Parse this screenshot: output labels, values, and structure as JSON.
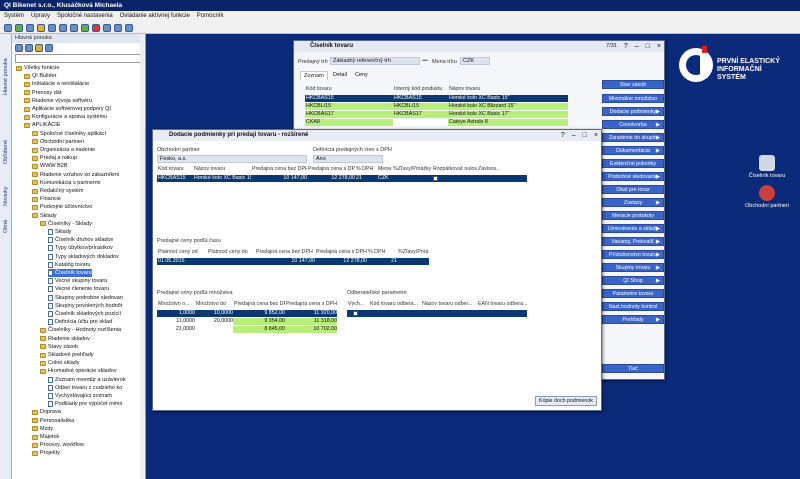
{
  "app": {
    "title": "QI  Bikenet s.r.o., Klusáčková Michaela"
  },
  "menu": [
    "Systém",
    "Úpravy",
    "Spoločné nastavenia",
    "Ovládanie aktívnej funkcie",
    "Pomocník"
  ],
  "vtabs": [
    "Hlavné ponuka",
    "Obľúbené",
    "Novinky",
    "Okná"
  ],
  "sidebar": {
    "title": "Hlavná ponuka",
    "items": [
      {
        "label": "Všetky funkcie",
        "t": "f",
        "lvl": 0
      },
      {
        "label": "QI Builder",
        "t": "f",
        "lvl": 1
      },
      {
        "label": "Inštalácie a reinštalácie",
        "t": "f",
        "lvl": 1
      },
      {
        "label": "Prenosy dát",
        "t": "f",
        "lvl": 1
      },
      {
        "label": "Riadenie vývoja softvéru",
        "t": "f",
        "lvl": 1
      },
      {
        "label": "Aplikácie softvérovej podpory QI",
        "t": "f",
        "lvl": 1
      },
      {
        "label": "Konfigurácie a správa systému",
        "t": "f",
        "lvl": 1
      },
      {
        "label": "APLIKÁCIE",
        "t": "f",
        "lvl": 1
      },
      {
        "label": "Spoločné číselníky aplikácí",
        "t": "f",
        "lvl": 2
      },
      {
        "label": "Obchodní partneri",
        "t": "f",
        "lvl": 2
      },
      {
        "label": "Organizácia a riadenie",
        "t": "f",
        "lvl": 2
      },
      {
        "label": "Predaj a nákup",
        "t": "f",
        "lvl": 2
      },
      {
        "label": "WWW B2B",
        "t": "f",
        "lvl": 2
      },
      {
        "label": "Riadenie vzťahov so zákazníkmi",
        "t": "f",
        "lvl": 2
      },
      {
        "label": "Komunikácia s partnermi",
        "t": "f",
        "lvl": 2
      },
      {
        "label": "Redakčný systém",
        "t": "f",
        "lvl": 2
      },
      {
        "label": "Financie",
        "t": "f",
        "lvl": 2
      },
      {
        "label": "Podvojné účtovníctvo",
        "t": "f",
        "lvl": 2
      },
      {
        "label": "Sklady",
        "t": "f",
        "lvl": 2
      },
      {
        "label": "Číselníky - Sklady",
        "t": "f",
        "lvl": 3
      },
      {
        "label": "Sklady",
        "t": "d",
        "lvl": 4
      },
      {
        "label": "Číselník druhov skladov",
        "t": "d",
        "lvl": 4
      },
      {
        "label": "Typy úbytkov/prírastkov",
        "t": "d",
        "lvl": 4
      },
      {
        "label": "Typy skladových dokladov",
        "t": "d",
        "lvl": 4
      },
      {
        "label": "Katalóg tovaru",
        "t": "d",
        "lvl": 4
      },
      {
        "label": "Číselník tovaru",
        "t": "d",
        "lvl": 4,
        "sel": true
      },
      {
        "label": "Vecné skupiny tovaru",
        "t": "d",
        "lvl": 4
      },
      {
        "label": "Vecné členenie tovaru",
        "t": "d",
        "lvl": 4
      },
      {
        "label": "Skupiny podrobne sledovan",
        "t": "d",
        "lvl": 4
      },
      {
        "label": "Skupiny povolených hodnôt",
        "t": "d",
        "lvl": 4
      },
      {
        "label": "Číselník skladových pozícií",
        "t": "d",
        "lvl": 4
      },
      {
        "label": "Definícia účtu pre sklad",
        "t": "d",
        "lvl": 4
      },
      {
        "label": "Číselníky - Hodnoty rozlíšenia",
        "t": "f",
        "lvl": 3
      },
      {
        "label": "Riadenie skladov",
        "t": "f",
        "lvl": 3
      },
      {
        "label": "Stavy zásob",
        "t": "f",
        "lvl": 3
      },
      {
        "label": "Skladové prehľady",
        "t": "f",
        "lvl": 3
      },
      {
        "label": "Colné sklady",
        "t": "f",
        "lvl": 3
      },
      {
        "label": "Hromadné operácie skladov",
        "t": "f",
        "lvl": 3
      },
      {
        "label": "Zoznam inventúr a uzávierok",
        "t": "d",
        "lvl": 4
      },
      {
        "label": "Odber tovaru z cudzieho ko",
        "t": "d",
        "lvl": 4
      },
      {
        "label": "Vychystávajúci zoznam",
        "t": "d",
        "lvl": 4
      },
      {
        "label": "Podklady pre výpočet mimir",
        "t": "d",
        "lvl": 4
      },
      {
        "label": "Doprava",
        "t": "f",
        "lvl": 2
      },
      {
        "label": "Personalistika",
        "t": "f",
        "lvl": 2
      },
      {
        "label": "Mzdy",
        "t": "f",
        "lvl": 2
      },
      {
        "label": "Majetok",
        "t": "f",
        "lvl": 2
      },
      {
        "label": "Procesy, workflow",
        "t": "f",
        "lvl": 2
      },
      {
        "label": "Projekty",
        "t": "f",
        "lvl": 2
      }
    ]
  },
  "logo": {
    "line1": "PRVNÍ ELASTICKÝ",
    "line2": "INFORMAČNÍ",
    "line3": "SYSTÉM"
  },
  "desktop_icons": [
    {
      "label": "Číselník tovaru"
    },
    {
      "label": "Obchodní partneri"
    }
  ],
  "main_win": {
    "title": "Číselník tovaru",
    "counter": "7/31",
    "pricelist_label": "Predajný trh",
    "pricelist_value": "Základný referenčný trh",
    "currency_label": "Mena trhu",
    "currency_value": "CZK",
    "tabs": [
      "Zoznam",
      "Detail",
      "Ceny"
    ],
    "columns": [
      "Kód tovaru",
      "Interný kód produktu",
      "Názov tovaru"
    ],
    "rows": [
      [
        "HKCBAS15",
        "HKCBAS15",
        "Horské kolo XC Basic 15\""
      ],
      [
        "HKCBLI15",
        "HKCBLI15",
        "Horské kolo XC Blizzard 15\""
      ],
      [
        "HKCBAS17",
        "HKCBAS17",
        "Horské kolo XC Basic 17\""
      ],
      [
        "CKA8",
        "",
        "Cateye Astrale 8"
      ]
    ],
    "buttons": [
      {
        "label": "Stav zásob",
        "arrow": false
      },
      {
        "label": "Minimálne množstvo",
        "arrow": false
      },
      {
        "label": "Dodacie podmienky",
        "arrow": true
      },
      {
        "label": "Cenotvorba",
        "arrow": true
      },
      {
        "label": "Zaradenie do skupín",
        "arrow": true
      },
      {
        "label": "Dokumentácia",
        "arrow": true
      },
      {
        "label": "Evidenčné jednotky",
        "arrow": false
      },
      {
        "label": "Podrobné sledovanie",
        "arrow": true
      },
      {
        "label": "Obal pre tovar",
        "arrow": false
      },
      {
        "label": "Zostavy",
        "arrow": true
      },
      {
        "label": "Meracie protokoly",
        "arrow": false
      },
      {
        "label": "Umiestnenie a sklady",
        "arrow": true
      },
      {
        "label": "Varianty, Prekvalif.",
        "arrow": true
      },
      {
        "label": "Príslušenstvo tovaru",
        "arrow": true
      },
      {
        "label": "Skupiny tovaru",
        "arrow": true
      },
      {
        "label": "QI Shop",
        "arrow": true
      },
      {
        "label": "Parametre tovaru",
        "arrow": false
      },
      {
        "label": "Nast.hodnoty kontrol",
        "arrow": false
      },
      {
        "label": "Prehľady",
        "arrow": true
      },
      {
        "label": "Tlač",
        "arrow": false
      }
    ]
  },
  "dodacie_win": {
    "title": "Dodacie podmienky pri predaji tovaru - rozšírené",
    "partner_label": "Obchodní partner",
    "partner_value": "Fesko, a.s.",
    "defin_label": "Definícia predajných cien s DPH",
    "defin_value": "Áno",
    "grid1": {
      "columns": [
        "Kód tovaru",
        "Názov tovaru",
        "Predajná cena bez DPH",
        "Predajná cena s DPH",
        "% DPH",
        "Mena",
        "%Zľavy/Prirážky",
        "Rozpätkovať nulovú cenu",
        "Závisos..."
      ],
      "row": [
        "HKCBAS15",
        "Horské kolo XC Basic 15\"",
        "10 147,00",
        "12 278,00",
        "21",
        "CZK",
        "",
        ""
      ]
    },
    "grid2": {
      "title": "Predajné ceny podľa času",
      "columns": [
        "Platnosť ceny od",
        "Platnosť ceny do",
        "Predajná cena bez DPH",
        "Predajná cena s DPH",
        "% DPH",
        "%Zľavy/Prirá..."
      ],
      "row": [
        "01.05.2016",
        "",
        "10 147,00",
        "12 278,00",
        "21",
        ""
      ]
    },
    "grid3": {
      "title": "Predajné ceny podľa množstva",
      "columns": [
        "Množstvo o...",
        "Množstvo do",
        "Predajná cena bez DPH",
        "Predajná cena s DPH"
      ],
      "rows": [
        [
          "1,0000",
          "10,0000",
          "9 852,00",
          "11 920,00"
        ],
        [
          "11,0000",
          "20,0000",
          "9 354,00",
          "11 318,00"
        ],
        [
          "21,0000",
          "",
          "8 845,00",
          "10 702,00"
        ]
      ]
    },
    "grid4": {
      "title": "Odberateľské parametre",
      "columns": [
        "Vých...",
        "Kód tovaru odbera...",
        "Názov tovaru odber...",
        "EAN tovaru odbera..."
      ]
    },
    "copy_button": "Kópie doch podmienok"
  }
}
